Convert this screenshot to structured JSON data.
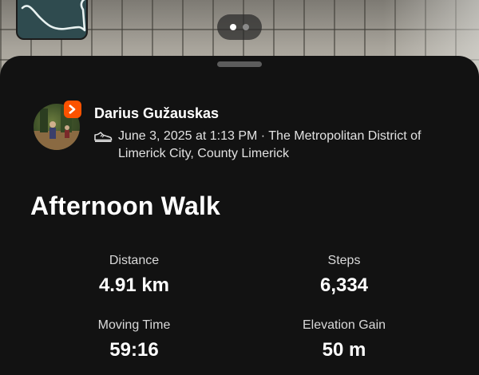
{
  "activity": {
    "athlete_name": "Darius Gužauskas",
    "meta": "June 3, 2025 at 1:13 PM · The Metropolitan District of Limerick City, County Limerick",
    "title": "Afternoon Walk",
    "sport_icon": "shoe-icon",
    "app_badge_color": "#fc5200"
  },
  "pager": {
    "count": 2,
    "active": 1
  },
  "stats": [
    {
      "label": "Distance",
      "value": "4.91 km"
    },
    {
      "label": "Steps",
      "value": "6,334"
    },
    {
      "label": "Moving Time",
      "value": "59:16"
    },
    {
      "label": "Elevation Gain",
      "value": "50 m"
    }
  ]
}
